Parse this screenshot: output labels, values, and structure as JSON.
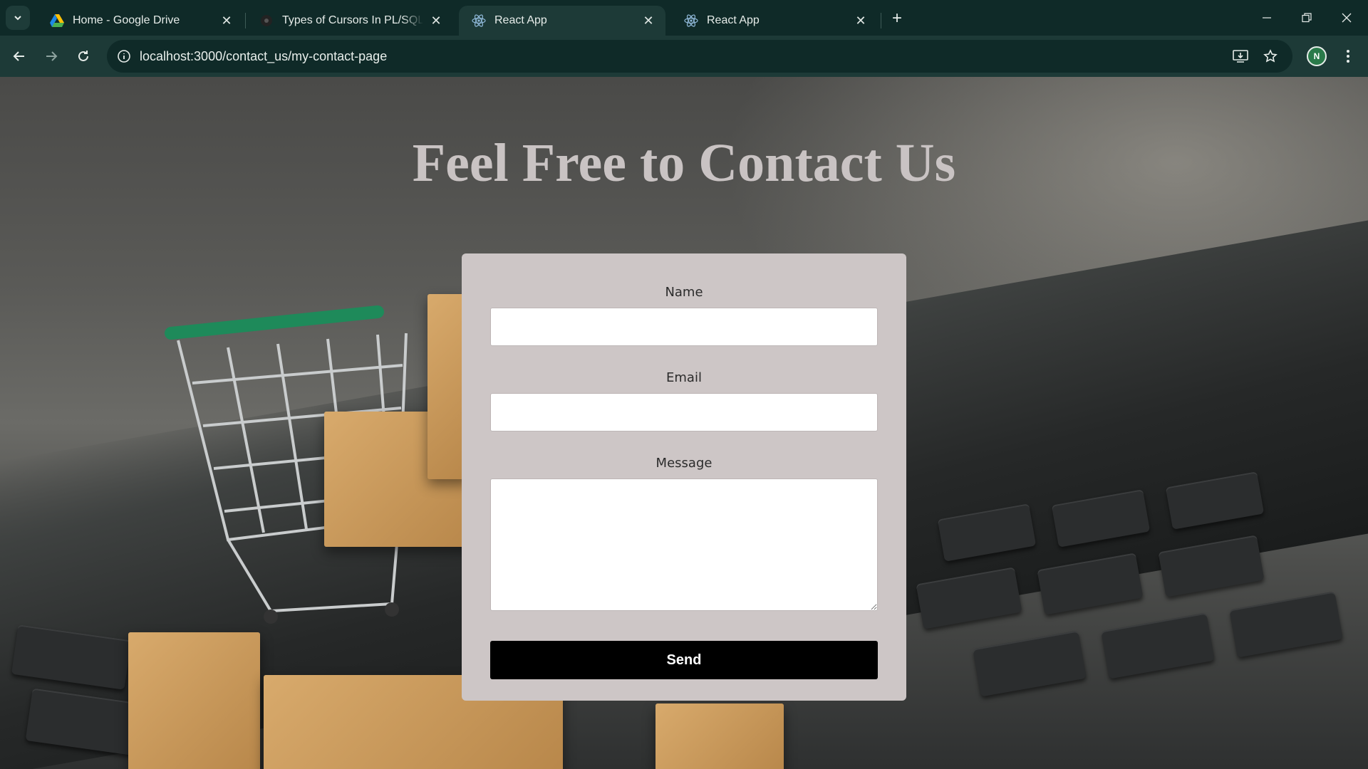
{
  "browser": {
    "tabs": [
      {
        "title": "Home - Google Drive",
        "favicon": "google-drive-icon",
        "active": false
      },
      {
        "title": "Types of Cursors In PL/SQL(Ora",
        "favicon": "site-icon",
        "active": false
      },
      {
        "title": "React App",
        "favicon": "react-icon",
        "active": true
      },
      {
        "title": "React App",
        "favicon": "react-icon",
        "active": false
      }
    ],
    "url": "localhost:3000/contact_us/my-contact-page",
    "avatar_initial": "N"
  },
  "page": {
    "heading": "Feel Free to Contact Us",
    "form": {
      "name_label": "Name",
      "name_value": "",
      "email_label": "Email",
      "email_value": "",
      "message_label": "Message",
      "message_value": "",
      "send_label": "Send"
    }
  },
  "colors": {
    "tabstrip_bg": "#0f2a28",
    "toolbar_bg": "#1d3a37",
    "card_bg": "#cdc6c6",
    "heading": "#c9c3c3",
    "send_bg": "#000000"
  }
}
